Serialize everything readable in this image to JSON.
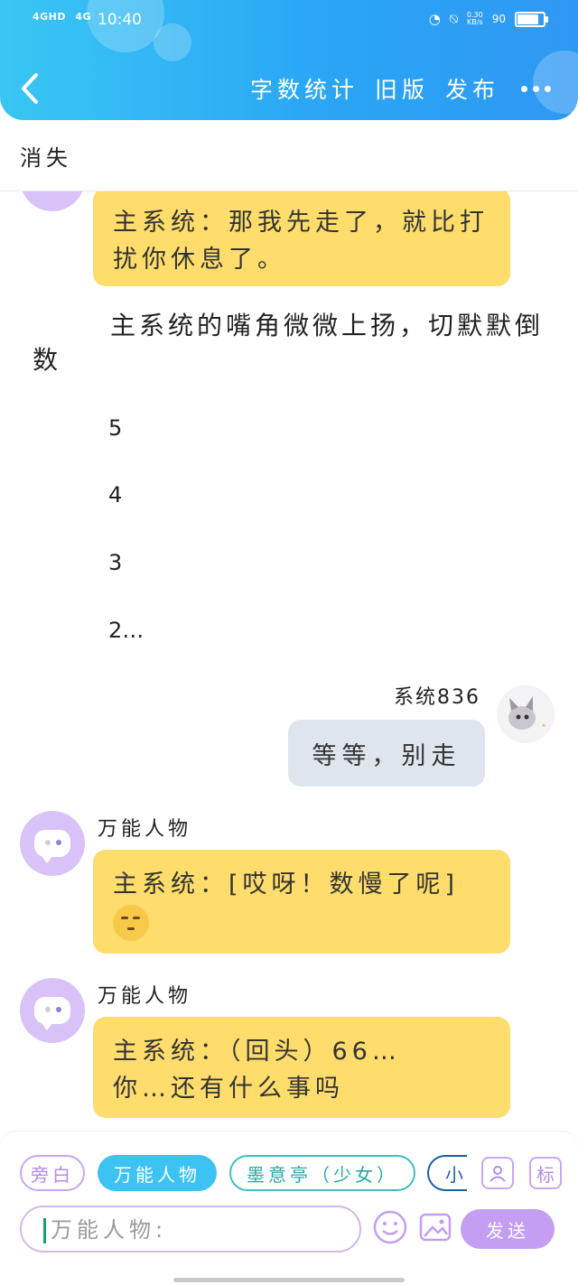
{
  "status_bar": {
    "signal_1": "4GHD",
    "signal_2": "4G",
    "time": "10:40",
    "net_speed": "0.30",
    "net_unit": "KB/s",
    "battery": "90",
    "battery_level": 0.9
  },
  "header": {
    "word_count": "字数统计",
    "old_version": "旧版",
    "publish": "发布"
  },
  "story": {
    "title": "消失"
  },
  "messages": {
    "m1": {
      "text": "主系统：那我先走了，就比打扰你休息了。"
    },
    "narration": "主系统的嘴角微微上扬，切默默倒数",
    "countdown": [
      "5",
      "4",
      "3",
      "2…"
    ],
    "me": {
      "name": "系统836",
      "text": "等等，别走"
    },
    "m2": {
      "sender": "万能人物",
      "text": "主系统：[哎呀！数慢了呢]"
    },
    "m3": {
      "sender": "万能人物",
      "line1": "主系统：（回头）66…",
      "line2": "你…还有什么事吗"
    }
  },
  "composer": {
    "chips": [
      "旁白",
      "万能人物",
      "墨意亭（少女）",
      "小"
    ],
    "tool_label": "标",
    "input_placeholder": "万能人物:",
    "send_label": "发送"
  },
  "colors": {
    "header": "#2aa6f5",
    "bubble_character": "#fedd6c",
    "bubble_self": "#dfe5ec",
    "accent_purple": "#c49ef2",
    "chip_active": "#3cc3f4"
  },
  "icons": [
    "back-icon",
    "more-icon",
    "alarm-icon",
    "mute-icon",
    "battery-icon",
    "avatar-settings-icon",
    "emoji-icon",
    "image-icon"
  ]
}
